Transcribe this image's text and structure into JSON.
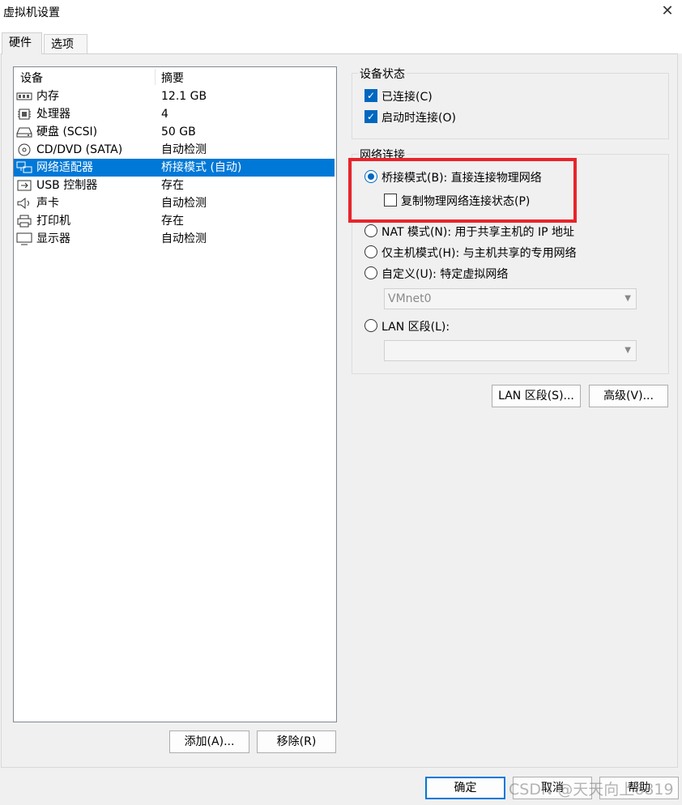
{
  "window": {
    "title": "虚拟机设置"
  },
  "tabs": [
    {
      "label": "硬件"
    },
    {
      "label": "选项"
    }
  ],
  "device_list": {
    "headers": {
      "device": "设备",
      "summary": "摘要"
    },
    "rows": [
      {
        "icon": "memory-icon",
        "name": "内存",
        "summary": "12.1 GB"
      },
      {
        "icon": "processor-icon",
        "name": "处理器",
        "summary": "4"
      },
      {
        "icon": "hard-disk-icon",
        "name": "硬盘 (SCSI)",
        "summary": "50 GB"
      },
      {
        "icon": "cd-dvd-icon",
        "name": "CD/DVD (SATA)",
        "summary": "自动检测"
      },
      {
        "icon": "network-adapter-icon",
        "name": "网络适配器",
        "summary": "桥接模式 (自动)"
      },
      {
        "icon": "usb-icon",
        "name": "USB 控制器",
        "summary": "存在"
      },
      {
        "icon": "sound-card-icon",
        "name": "声卡",
        "summary": "自动检测"
      },
      {
        "icon": "printer-icon",
        "name": "打印机",
        "summary": "存在"
      },
      {
        "icon": "display-icon",
        "name": "显示器",
        "summary": "自动检测"
      }
    ],
    "selected_index": 4
  },
  "list_buttons": {
    "add": "添加(A)...",
    "remove": "移除(R)"
  },
  "device_status": {
    "title": "设备状态",
    "connected": {
      "label": "已连接(C)",
      "checked": true
    },
    "connect_at_power_on": {
      "label": "启动时连接(O)",
      "checked": true
    }
  },
  "network_connection": {
    "title": "网络连接",
    "bridged": {
      "label": "桥接模式(B): 直接连接物理网络",
      "selected": true
    },
    "replicate": {
      "label": "复制物理网络连接状态(P)",
      "checked": false
    },
    "nat": {
      "label": "NAT 模式(N): 用于共享主机的 IP 地址",
      "selected": false
    },
    "host_only": {
      "label": "仅主机模式(H): 与主机共享的专用网络",
      "selected": false
    },
    "custom": {
      "label": "自定义(U): 特定虚拟网络",
      "selected": false
    },
    "custom_combo": {
      "value": "VMnet0"
    },
    "lan_segment": {
      "label": "LAN 区段(L):",
      "selected": false
    },
    "lan_combo": {
      "value": ""
    }
  },
  "right_buttons": {
    "lan_segments": "LAN 区段(S)...",
    "advanced": "高级(V)..."
  },
  "footer": {
    "ok": "确定",
    "cancel": "取消",
    "help": "帮助"
  },
  "watermark": "CSDN @天天向上6819",
  "colors": {
    "selection": "#0078d7",
    "highlight_box": "#e8242a",
    "accent": "#0067c0"
  }
}
